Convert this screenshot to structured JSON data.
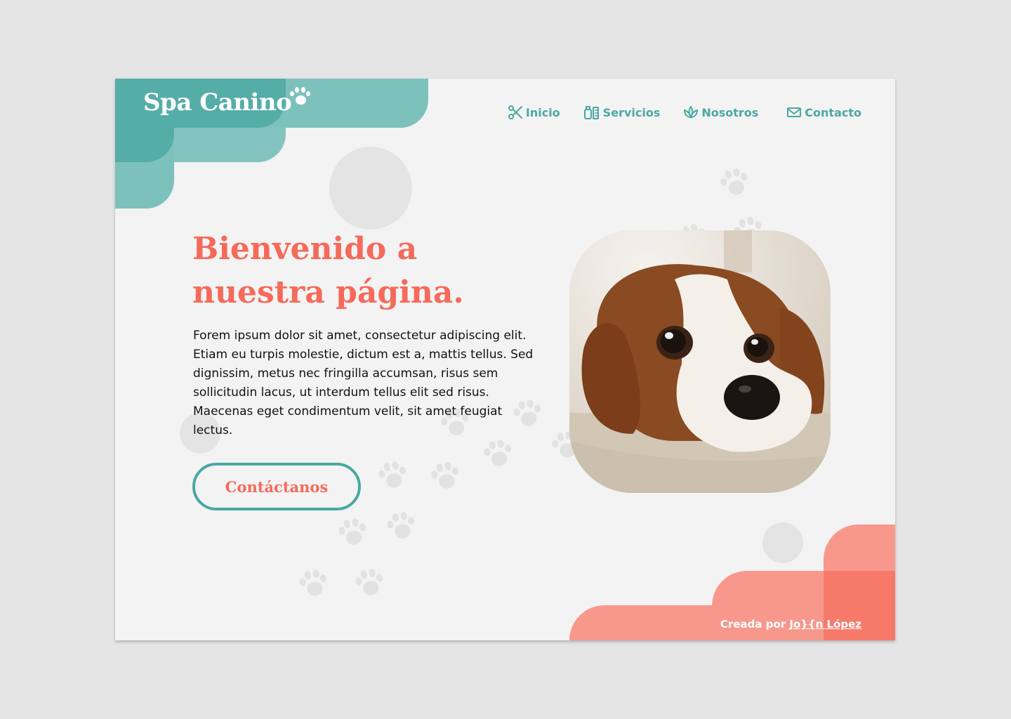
{
  "brand": {
    "name": "Spa Canino",
    "icon": "paw-icon"
  },
  "nav": [
    {
      "label": "Inicio",
      "icon": "scissors-icon"
    },
    {
      "label": "Servicios",
      "icon": "grooming-kit-icon"
    },
    {
      "label": "Nosotros",
      "icon": "lotus-icon"
    },
    {
      "label": "Contacto",
      "icon": "envelope-icon"
    }
  ],
  "hero": {
    "title": "Bienvenido a nuestra página.",
    "body": "Forem ipsum dolor sit amet, consectetur adipiscing elit. Etiam eu turpis molestie, dictum est a, mattis tellus. Sed dignissim, metus nec fringilla accumsan, risus sem sollicitudin lacus, ut interdum tellus elit sed risus. Maecenas eget condimentum velit, sit amet feugiat lectus.",
    "cta_label": "Contáctanos",
    "image": "puppy-photo"
  },
  "footer": {
    "prefix": "Creada por",
    "author": "Jo}{n López"
  },
  "colors": {
    "background": "#f3f3f3",
    "teal": "#7dc1bd",
    "teal_dark": "#55ada8",
    "nav_text": "#4aa8a3",
    "coral": "#f8988c",
    "coral_text": "#f56a5a"
  }
}
